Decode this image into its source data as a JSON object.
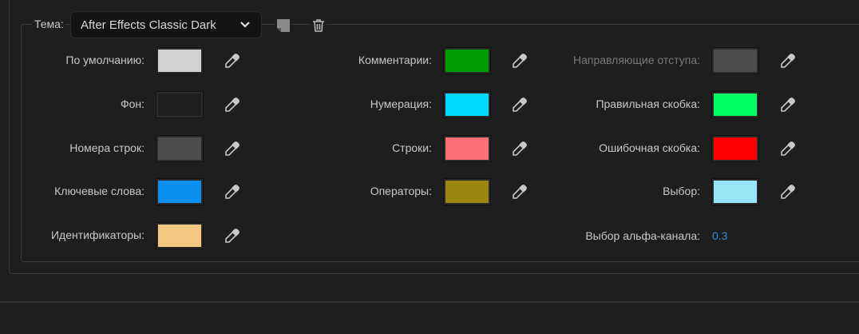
{
  "theme": {
    "label": "Тема:",
    "selected": "After Effects Classic Dark"
  },
  "columns": [
    [
      {
        "label": "По умолчанию:",
        "color": "#d1d1d1"
      },
      {
        "label": "Фон:",
        "color": "#1e1e1e"
      },
      {
        "label": "Номера строк:",
        "color": "#4d4d4d"
      },
      {
        "label": "Ключевые слова:",
        "color": "#0a8ff0"
      },
      {
        "label": "Идентификаторы:",
        "color": "#f3c981"
      }
    ],
    [
      {
        "label": "Комментарии:",
        "color": "#009d00"
      },
      {
        "label": "Нумерация:",
        "color": "#00d9ff"
      },
      {
        "label": "Строки:",
        "color": "#fe6e76"
      },
      {
        "label": "Операторы:",
        "color": "#9b8611"
      }
    ],
    [
      {
        "label": "Направляющие отступа:",
        "color": "#4d4d4d",
        "dim": true
      },
      {
        "label": "Правильная скобка:",
        "color": "#00fe64"
      },
      {
        "label": "Ошибочная скобка:",
        "color": "#fe0000"
      },
      {
        "label": "Выбор:",
        "color": "#96e6f8"
      }
    ]
  ],
  "alpha": {
    "label": "Выбор альфа-канала:",
    "value": "0.3"
  }
}
